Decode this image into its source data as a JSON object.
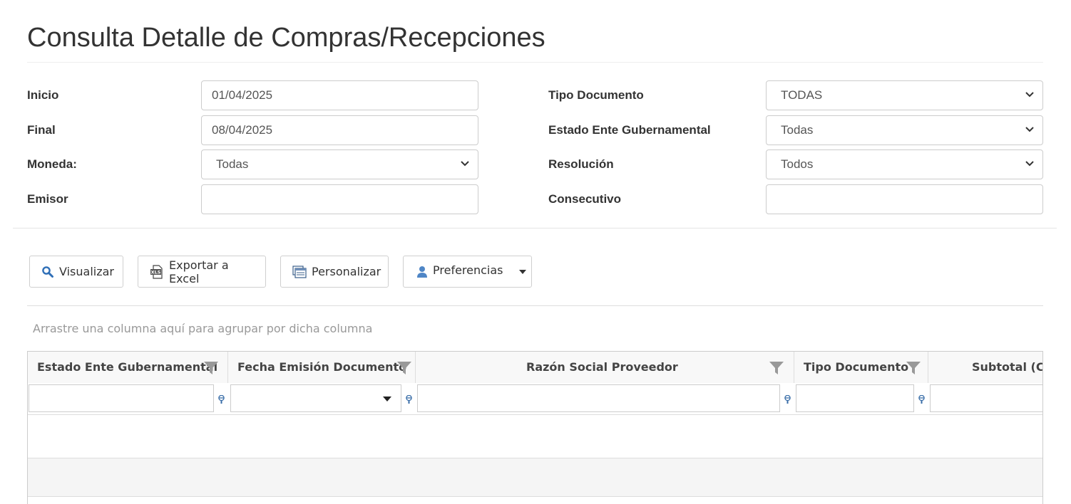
{
  "page": {
    "title": "Consulta Detalle de Compras/Recepciones"
  },
  "filters": {
    "inicio": {
      "label": "Inicio",
      "value": "01/04/2025"
    },
    "final": {
      "label": "Final",
      "value": "08/04/2025"
    },
    "moneda": {
      "label": "Moneda:",
      "value": "Todas"
    },
    "emisor": {
      "label": "Emisor",
      "value": ""
    },
    "tipo_documento": {
      "label": "Tipo Documento",
      "value": "TODAS"
    },
    "estado_ente": {
      "label": "Estado Ente Gubernamental",
      "value": "Todas"
    },
    "resolucion": {
      "label": "Resolución",
      "value": "Todos"
    },
    "consecutivo": {
      "label": "Consecutivo",
      "value": ""
    }
  },
  "toolbar": {
    "visualizar": "Visualizar",
    "exportar": "Exportar a Excel",
    "personalizar": "Personalizar",
    "preferencias": "Preferencias",
    "xls_icon_text": "XLS"
  },
  "grid": {
    "group_hint": "Arrastre una columna aquí para agrupar por dicha columna",
    "columns": [
      {
        "label": "Estado Ente Gubernamental"
      },
      {
        "label": "Fecha Emisión Documento"
      },
      {
        "label": "Razón Social Proveedor"
      },
      {
        "label": "Tipo Documento"
      },
      {
        "label": "Subtotal (CR"
      }
    ],
    "rows": []
  },
  "colors": {
    "accent": "#337ab7",
    "border": "#cccccc",
    "header_bg": "#f8f8f8",
    "alt_row_bg": "#f5f5f5",
    "funnel": "#999999"
  }
}
